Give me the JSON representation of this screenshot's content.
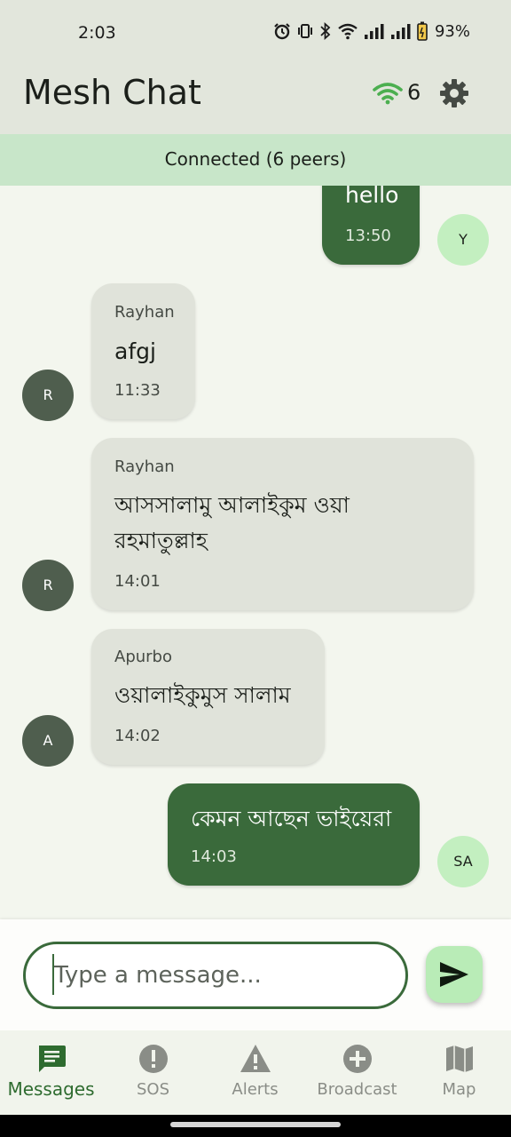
{
  "status_bar": {
    "time": "2:03",
    "battery": "93%"
  },
  "app_bar": {
    "title": "Mesh Chat",
    "peer_count": "6"
  },
  "connection_banner": "Connected (6 peers)",
  "messages": [
    {
      "direction": "outgoing",
      "text": "hello",
      "time": "13:50",
      "avatar": "Y"
    },
    {
      "direction": "incoming",
      "sender": "Rayhan",
      "text": "afgj",
      "time": "11:33",
      "avatar": "R"
    },
    {
      "direction": "incoming",
      "sender": "Rayhan",
      "text_lines": [
        "আসসালামু আলাইকুম ওয়া",
        "রহমাতুল্লাহ"
      ],
      "time": "14:01",
      "avatar": "R"
    },
    {
      "direction": "incoming",
      "sender": "Apurbo",
      "text": "ওয়ালাইকুমুস সালাম",
      "time": "14:02",
      "avatar": "A"
    },
    {
      "direction": "outgoing",
      "text": "কেমন আছেন ভাইয়েরা",
      "time": "14:03",
      "avatar": "SA"
    }
  ],
  "composer": {
    "placeholder": "Type a message...",
    "send_icon": "send-icon"
  },
  "bottom_nav": [
    {
      "label": "Messages",
      "icon": "chat-icon",
      "active": true
    },
    {
      "label": "SOS",
      "icon": "exclamation-icon",
      "active": false
    },
    {
      "label": "Alerts",
      "icon": "warning-icon",
      "active": false
    },
    {
      "label": "Broadcast",
      "icon": "add-circle-icon",
      "active": false
    },
    {
      "label": "Map",
      "icon": "map-icon",
      "active": false
    }
  ],
  "colors": {
    "primary": "#3a6a3b",
    "banner": "#c8e6c9",
    "incoming_bubble": "#e0e3da",
    "wifi_accent": "#4caf50",
    "active_nav": "#2e6b2f"
  }
}
